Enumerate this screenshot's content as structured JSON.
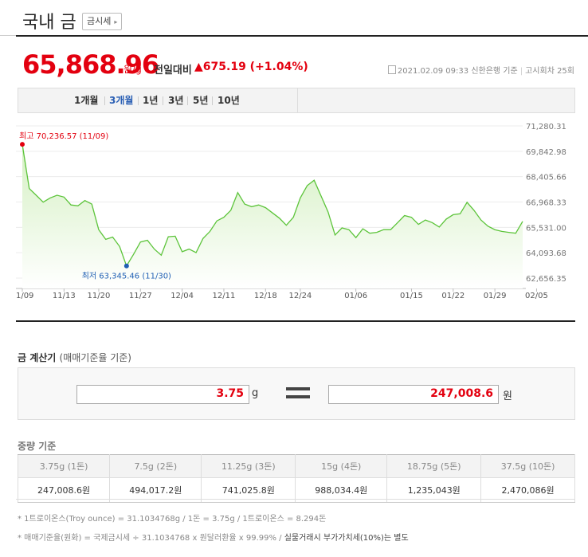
{
  "header": {
    "title": "국내 금",
    "quote_button": "금시세",
    "quote_chev": "▸"
  },
  "price": {
    "value": "65,868.96",
    "unit": "원/g",
    "compare_label": "전일대비",
    "change_arrow": "▲",
    "change_text": "675.19 (+1.04%)"
  },
  "meta": {
    "datetime": "2021.02.09 09:33",
    "source": "신한은행 기준",
    "round": "고시회차 25회"
  },
  "tabs": [
    {
      "label": "1개월"
    },
    {
      "label": "3개월"
    },
    {
      "label": "1년"
    },
    {
      "label": "3년"
    },
    {
      "label": "5년"
    },
    {
      "label": "10년"
    }
  ],
  "chart_data": {
    "type": "area",
    "title": "",
    "y_ticks": [
      "71,280.31",
      "69,842.98",
      "68,405.66",
      "66,968.33",
      "65,531.00",
      "64,093.68",
      "62,656.35"
    ],
    "y_tick_values": [
      71280.31,
      69842.98,
      68405.66,
      66968.33,
      65531.0,
      64093.68,
      62656.35
    ],
    "ylim": [
      62656.35,
      71280.31
    ],
    "x_ticks": [
      "11/09",
      "11/13",
      "11/20",
      "11/27",
      "12/04",
      "12/11",
      "12/18",
      "12/24",
      "01/06",
      "01/15",
      "01/22",
      "01/29",
      "02/05"
    ],
    "x_tick_index": [
      0,
      6,
      11,
      17,
      23,
      29,
      35,
      40,
      48,
      56,
      62,
      68,
      74
    ],
    "series": [
      {
        "values": [
          70236.57,
          67730,
          67350,
          66960,
          67200,
          67350,
          67250,
          66800,
          66750,
          67050,
          66850,
          65400,
          64850,
          64980,
          64450,
          63345.46,
          64000,
          64700,
          64800,
          64300,
          63950,
          65000,
          65030,
          64150,
          64300,
          64100,
          64900,
          65300,
          65900,
          66100,
          66500,
          67500,
          66850,
          66700,
          66800,
          66650,
          66350,
          66050,
          65650,
          66100,
          67200,
          67900,
          68200,
          67300,
          66400,
          65100,
          65500,
          65400,
          64950,
          65450,
          65200,
          65250,
          65400,
          65400,
          65800,
          66200,
          66100,
          65700,
          65950,
          65800,
          65550,
          66000,
          66250,
          66300,
          66950,
          66500,
          65950,
          65600,
          65400,
          65300,
          65250,
          65200,
          65868.96
        ]
      }
    ],
    "high_label": "최고 70,236.57 (11/09)",
    "low_label": "최저 63,345.46 (11/30)",
    "line_color": "#5cc43a",
    "fill_top_color": "#d4f0c2",
    "fill_bottom_color": "#ffffff"
  },
  "calculator": {
    "title": "금 계산기",
    "subtitle": "(매매기준율 기준)",
    "weight_value": "3.75",
    "weight_unit": "g",
    "result_value": "247,008.6",
    "result_unit": "원"
  },
  "weight_table": {
    "title": "중량 기준",
    "headers": [
      "3.75g (1돈)",
      "7.5g (2돈)",
      "11.25g (3돈)",
      "15g (4돈)",
      "18.75g (5돈)",
      "37.5g (10돈)"
    ],
    "values": [
      "247,008.6원",
      "494,017.2원",
      "741,025.8원",
      "988,034.4원",
      "1,235,043원",
      "2,470,086원"
    ]
  },
  "notes": [
    "* 1트로이온스(Troy ounce) = 31.1034768g / 1돈 = 3.75g / 1트로이온스 = 8.294돈",
    "* 매매기준율(원화) = 국제금시세 ÷ 31.1034768 x 원달러환율 x 99.99% / ",
    "실물거래시 부가가치세(10%)는 별도"
  ],
  "colors": {
    "accent_red": "#e3000f",
    "tab_active": "#2a5fb4",
    "high_marker": "#e3000f",
    "low_marker": "#1f5fb4"
  }
}
